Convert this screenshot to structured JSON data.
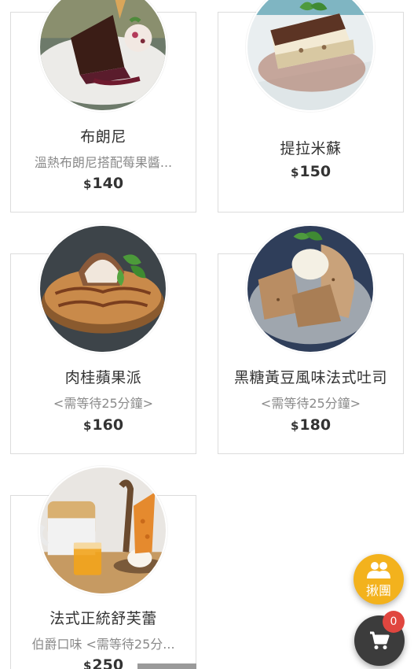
{
  "products": [
    {
      "name": "布朗尼",
      "description": "溫熱布朗尼搭配莓果醬...",
      "currency": "$",
      "price": "140",
      "image_icon": "brownie-icon"
    },
    {
      "name": "提拉米蘇",
      "description": "",
      "currency": "$",
      "price": "150",
      "image_icon": "tiramisu-icon"
    },
    {
      "name": "肉桂蘋果派",
      "description": "<需等待25分鐘>",
      "currency": "$",
      "price": "160",
      "image_icon": "apple-pie-icon"
    },
    {
      "name": "黑糖黃豆風味法式吐司",
      "description": "<需等待25分鐘>",
      "currency": "$",
      "price": "180",
      "image_icon": "french-toast-icon"
    },
    {
      "name": "法式正統舒芙蕾",
      "description": "伯爵口味 <需等待25分...",
      "currency": "$",
      "price": "250",
      "image_icon": "souffle-icon"
    }
  ],
  "group_button": {
    "label": "揪團",
    "icon": "group-icon",
    "color": "#f3b21d"
  },
  "cart": {
    "count": "0",
    "icon": "cart-icon",
    "badge_color": "#e0463f",
    "button_color": "#3c3c3c"
  }
}
